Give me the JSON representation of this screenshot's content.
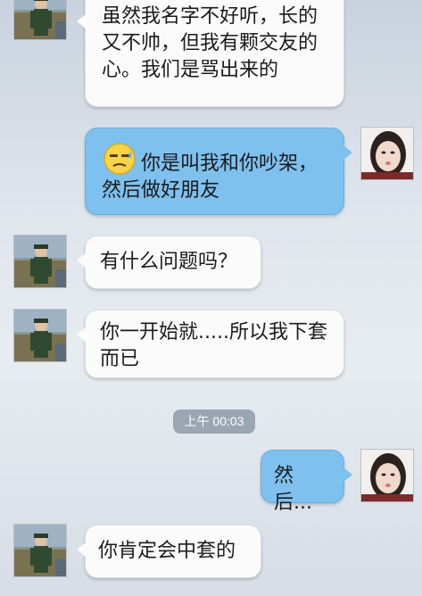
{
  "messages": [
    {
      "side": "left",
      "text": "虽然我名字不好听，长的又不帅，但我有颗交友的心。我们是骂出来的"
    },
    {
      "side": "right",
      "emoji": "awkward-face-icon",
      "text": "你是叫我和你吵架，然后做好朋友"
    },
    {
      "side": "left",
      "text": "有什么问题吗？"
    },
    {
      "side": "left",
      "text": "你一开始就.....所以我下套而已"
    },
    {
      "side": "right",
      "text": "然后..."
    },
    {
      "side": "left",
      "text": "你肯定会中套的"
    }
  ],
  "timestamp": "上午 00:03"
}
